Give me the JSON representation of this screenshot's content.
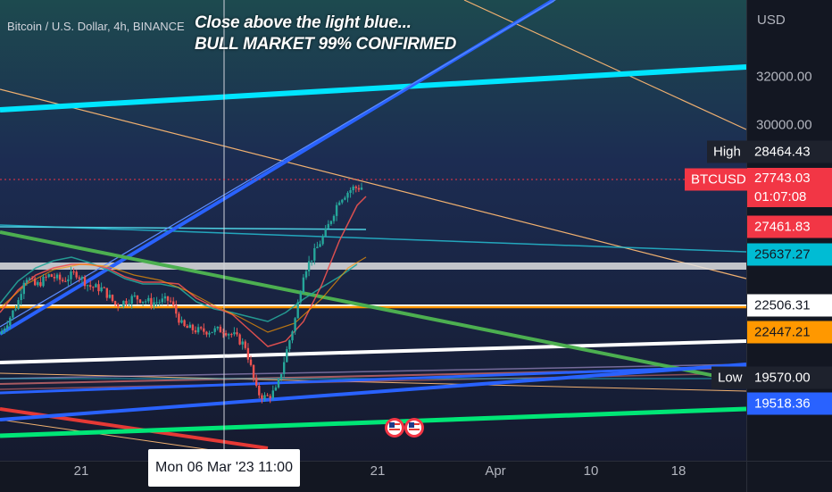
{
  "header": {
    "symbol_legend": "Bitcoin / U.S. Dollar, 4h, BINANCE"
  },
  "idea": {
    "line1": "Close above the light blue...",
    "line2": "BULL MARKET 99% CONFIRMED"
  },
  "price_scale": {
    "currency": "USD",
    "ticks": [
      "32000.00",
      "30000.00"
    ]
  },
  "time_scale": {
    "labels": [
      "21",
      "21",
      "Apr",
      "10",
      "18"
    ],
    "crosshair_label": "Mon 06 Mar '23   11:00"
  },
  "price_tags": {
    "high_label": "High",
    "high_value": "28464.43",
    "symbol_label": "BTCUSD",
    "last_value": "27743.03",
    "countdown": "01:07:08",
    "tag_27461": "27461.83",
    "tag_25637": "25637.27",
    "tag_22506": "22506.31",
    "tag_22447": "22447.21",
    "low_label": "Low",
    "low_value": "19570.00",
    "tag_19518": "19518.36"
  },
  "colors": {
    "background": "#131722",
    "price_up": "#26a69a",
    "price_down": "#ef5350",
    "light_blue_line": "#00bcd4",
    "blue_line": "#2962ff",
    "green_line": "#4caf50",
    "bright_green_line": "#00e676",
    "white_line": "#ffffff",
    "orange_line": "#ff9800",
    "red_line": "#f23645",
    "high_tag": "#1e222d",
    "last_tag": "#f23645",
    "tag_27461": "#f23645",
    "tag_25637": "#00bcd4",
    "tag_22506": "#ffffff",
    "tag_22447": "#ff9800",
    "tag_19518": "#2962ff"
  },
  "events": {
    "icons": [
      "us-flag-icon",
      "us-flag-icon"
    ]
  },
  "chart_data": {
    "type": "candlestick",
    "title": "",
    "ylabel": "USD",
    "ylim": [
      17700,
      34600
    ],
    "grid": false,
    "legend": "none",
    "xlabels": [
      "21",
      "Mon 06 Mar '23 11:00",
      "21",
      "Apr",
      "10",
      "18"
    ],
    "series": [
      {
        "name": "BTCUSD",
        "close_points": [
          [
            0,
            22350
          ],
          [
            10,
            22900
          ],
          [
            20,
            23500
          ],
          [
            28,
            24500
          ],
          [
            40,
            24100
          ],
          [
            55,
            24500
          ],
          [
            70,
            24300
          ],
          [
            85,
            24600
          ],
          [
            100,
            24100
          ],
          [
            115,
            24000
          ],
          [
            130,
            23400
          ],
          [
            150,
            23700
          ],
          [
            170,
            23500
          ],
          [
            190,
            23600
          ],
          [
            205,
            22600
          ],
          [
            225,
            22450
          ],
          [
            250,
            22500
          ],
          [
            262,
            22300
          ],
          [
            275,
            21900
          ],
          [
            288,
            20200
          ],
          [
            298,
            20000
          ],
          [
            310,
            20300
          ],
          [
            320,
            21600
          ],
          [
            330,
            22800
          ],
          [
            340,
            24600
          ],
          [
            350,
            25200
          ],
          [
            365,
            26100
          ],
          [
            380,
            27300
          ],
          [
            395,
            27700
          ],
          [
            408,
            27743
          ]
        ]
      }
    ],
    "horizontal_levels": [
      {
        "value": 25637.27
      },
      {
        "value": 24000
      },
      {
        "value": 22506.31
      },
      {
        "value": 22447.21
      }
    ],
    "trendlines": [
      {
        "color": "light_blue",
        "from": [
          0,
          30600
        ],
        "to": [
          836,
          32600
        ]
      },
      {
        "color": "blue",
        "from": [
          0,
          20800
        ],
        "to": [
          620,
          35000
        ]
      },
      {
        "color": "white",
        "from": [
          0,
          19900
        ],
        "to": [
          836,
          21250
        ]
      },
      {
        "color": "green",
        "from": [
          0,
          25700
        ],
        "to": [
          836,
          19450
        ]
      },
      {
        "color": "bright_green",
        "from": [
          0,
          17600
        ],
        "to": [
          836,
          18800
        ]
      },
      {
        "color": "blue",
        "from": [
          0,
          18400
        ],
        "to": [
          836,
          20300
        ]
      }
    ]
  }
}
